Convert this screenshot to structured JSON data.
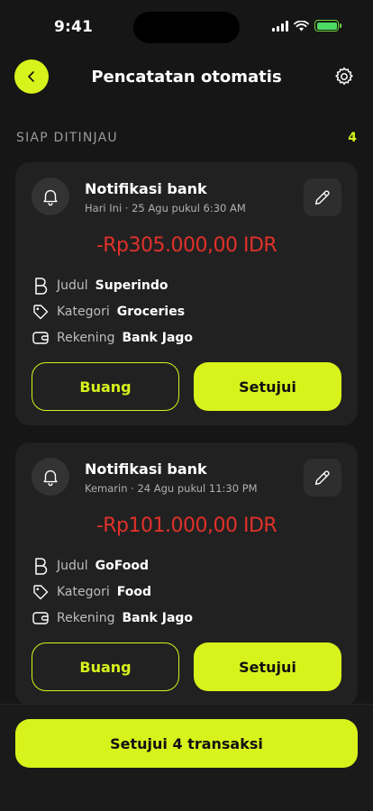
{
  "status_bar": {
    "time": "9:41",
    "icons": [
      "signal-icon",
      "wifi-icon",
      "battery-charging-icon"
    ]
  },
  "header": {
    "title": "Pencatatan otomatis",
    "back_icon": "chevron-left-icon",
    "settings_icon": "gear-icon"
  },
  "section": {
    "label": "SIAP DITINJAU",
    "count": "4"
  },
  "colors": {
    "accent": "#d8f21c",
    "amount": "#e0312a",
    "background": "#161616",
    "card": "#212121"
  },
  "transactions": [
    {
      "source": "Notifikasi bank",
      "timestamp": "Hari Ini · 25 Agu pukul 6:30 AM",
      "amount": "-Rp305.000,00 IDR",
      "title_label": "Judul",
      "title_value": "Superindo",
      "category_label": "Kategori",
      "category_value": "Groceries",
      "account_label": "Rekening",
      "account_value": "Bank Jago",
      "discard_label": "Buang",
      "approve_label": "Setujui"
    },
    {
      "source": "Notifikasi bank",
      "timestamp": "Kemarin · 24 Agu pukul 11:30 PM",
      "amount": "-Rp101.000,00 IDR",
      "title_label": "Judul",
      "title_value": "GoFood",
      "category_label": "Kategori",
      "category_value": "Food",
      "account_label": "Rekening",
      "account_value": "Bank Jago",
      "discard_label": "Buang",
      "approve_label": "Setujui"
    }
  ],
  "footer": {
    "approve_all_label": "Setujui 4 transaksi"
  }
}
